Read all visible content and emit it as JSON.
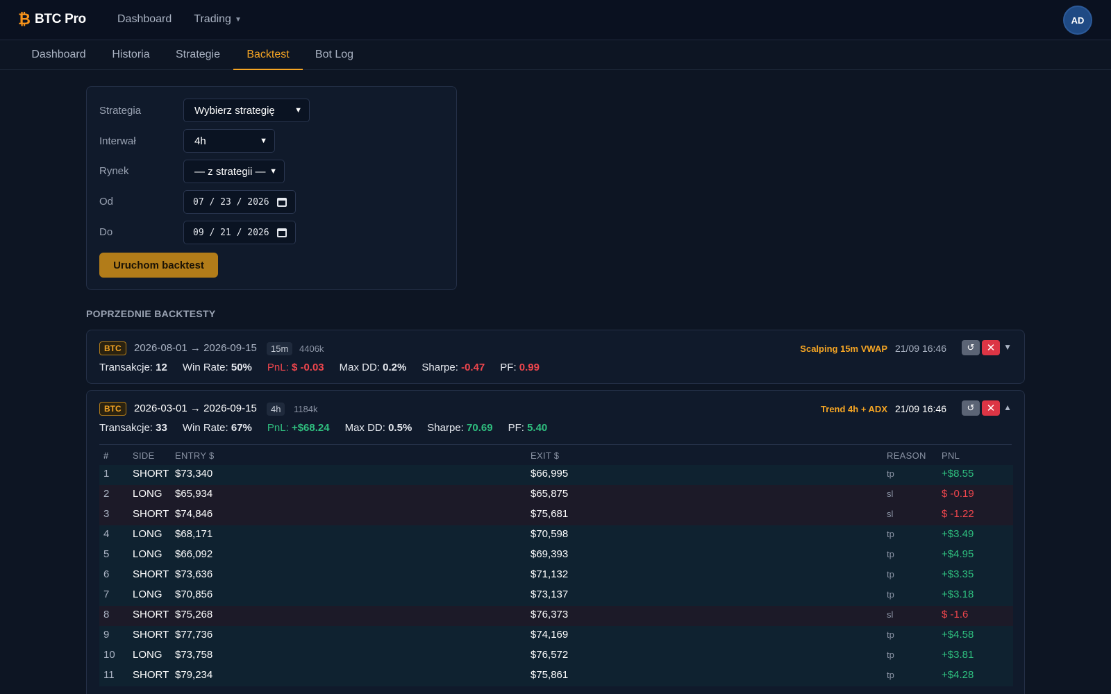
{
  "brand": {
    "name": "BTC Pro",
    "icon": "bitcoin-icon"
  },
  "topnav": {
    "dashboard": "Dashboard",
    "trading": "Trading"
  },
  "user": {
    "initials": "AD"
  },
  "tabs": [
    "Dashboard",
    "Historia",
    "Strategie",
    "Backtest",
    "Bot Log"
  ],
  "active_tab": "Backtest",
  "form": {
    "strategy_label": "Strategia",
    "strategy_value": "Wybierz strategię",
    "interval_label": "Interwał",
    "interval_value": "4h",
    "market_label": "Rynek",
    "market_value": "— z strategii —",
    "from_label": "Od",
    "from_value": "07 / 23 / 2026",
    "to_label": "Do",
    "to_value": "09 / 21 / 2026",
    "run_label": "Uruchom backtest"
  },
  "section_title": "POPRZEDNIE BACKTESTY",
  "backtests": [
    {
      "market": "BTC",
      "range": "2026-08-01 → 2026-09-15",
      "interval": "15m",
      "candles": "4406k",
      "strategy": "Scalping 15m VWAP",
      "time": "21/09 16:46",
      "expanded": false,
      "toggle": "▼",
      "stats": {
        "trades_label": "Transakcje:",
        "trades": "12",
        "winrate_label": "Win Rate:",
        "winrate": "50%",
        "pnl_label": "PnL:",
        "pnl": "$ -0.03",
        "maxdd_label": "Max DD:",
        "maxdd": "0.2%",
        "sharpe_label": "Sharpe:",
        "sharpe": "-0.47",
        "pf_label": "PF:",
        "pf": "0.99"
      }
    },
    {
      "market": "BTC",
      "range": "2026-03-01 → 2026-09-15",
      "interval": "4h",
      "candles": "1184k",
      "strategy": "Trend 4h + ADX",
      "time": "21/09 16:46",
      "expanded": true,
      "toggle": "▲",
      "stats": {
        "trades_label": "Transakcje:",
        "trades": "33",
        "winrate_label": "Win Rate:",
        "winrate": "67%",
        "pnl_label": "PnL:",
        "pnl": "+$68.24",
        "maxdd_label": "Max DD:",
        "maxdd": "0.5%",
        "sharpe_label": "Sharpe:",
        "sharpe": "70.69",
        "pf_label": "PF:",
        "pf": "5.40"
      },
      "columns": [
        "#",
        "SIDE",
        "ENTRY $",
        "EXIT $",
        "REASON",
        "PNL"
      ],
      "trades": [
        {
          "n": "1",
          "side": "SHORT",
          "entry": "$73,340",
          "exit": "$66,995",
          "reason": "tp",
          "pnl": "+$8.55"
        },
        {
          "n": "2",
          "side": "LONG",
          "entry": "$65,934",
          "exit": "$65,875",
          "reason": "sl",
          "pnl": "$ -0.19"
        },
        {
          "n": "3",
          "side": "SHORT",
          "entry": "$74,846",
          "exit": "$75,681",
          "reason": "sl",
          "pnl": "$ -1.22"
        },
        {
          "n": "4",
          "side": "LONG",
          "entry": "$68,171",
          "exit": "$70,598",
          "reason": "tp",
          "pnl": "+$3.49"
        },
        {
          "n": "5",
          "side": "LONG",
          "entry": "$66,092",
          "exit": "$69,393",
          "reason": "tp",
          "pnl": "+$4.95"
        },
        {
          "n": "6",
          "side": "SHORT",
          "entry": "$73,636",
          "exit": "$71,132",
          "reason": "tp",
          "pnl": "+$3.35"
        },
        {
          "n": "7",
          "side": "LONG",
          "entry": "$70,856",
          "exit": "$73,137",
          "reason": "tp",
          "pnl": "+$3.18"
        },
        {
          "n": "8",
          "side": "SHORT",
          "entry": "$75,268",
          "exit": "$76,373",
          "reason": "sl",
          "pnl": "$ -1.6"
        },
        {
          "n": "9",
          "side": "SHORT",
          "entry": "$77,736",
          "exit": "$74,169",
          "reason": "tp",
          "pnl": "+$4.58"
        },
        {
          "n": "10",
          "side": "LONG",
          "entry": "$73,758",
          "exit": "$76,572",
          "reason": "tp",
          "pnl": "+$3.81"
        },
        {
          "n": "11",
          "side": "SHORT",
          "entry": "$79,234",
          "exit": "$75,861",
          "reason": "tp",
          "pnl": "+$4.28"
        }
      ]
    }
  ],
  "colors": {
    "accent": "#f5a524",
    "positive": "#2fbf7f",
    "negative": "#f0464d",
    "background": "#0d1523"
  }
}
